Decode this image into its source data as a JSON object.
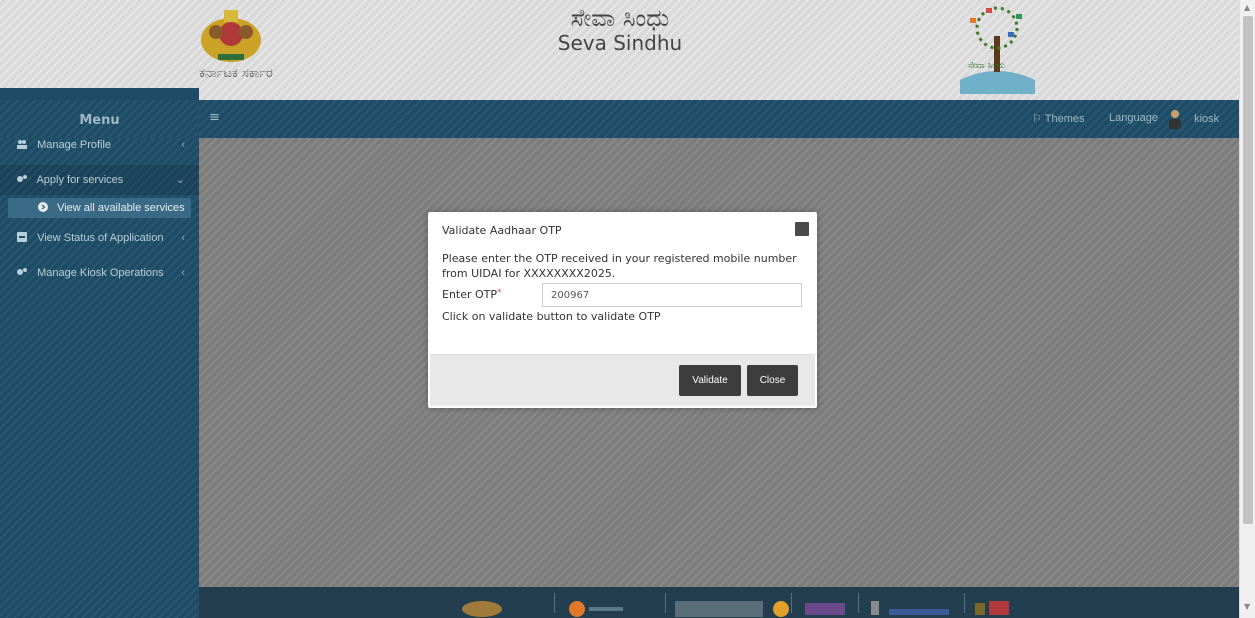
{
  "header": {
    "state_name": "ಕರ್ನಾಟಕ ಸರ್ಕಾರ",
    "title_kannada": "ಸೇವಾ ಸಿಂಧು",
    "title_english": "Seva Sindhu",
    "logo_text": "ಸೇವಾ ಸಿಂಧು"
  },
  "sidebar": {
    "menu_label": "Menu",
    "items": [
      {
        "label": "Manage Profile",
        "icon": "users-icon"
      },
      {
        "label": "Apply for services",
        "icon": "gears-icon"
      },
      {
        "label": "View all available services",
        "icon": "arrow-circle-icon"
      },
      {
        "label": "View Status of Application",
        "icon": "tablet-icon"
      },
      {
        "label": "Manage Kiosk Operations",
        "icon": "gears-icon"
      }
    ]
  },
  "topbar": {
    "hamburger_icon": "hamburger-icon",
    "themes_label": "Themes",
    "language_label": "Language",
    "user_label": "kiosk"
  },
  "modal": {
    "title": "Validate Aadhaar OTP",
    "message": "Please enter the OTP received in your registered mobile number from UIDAI for XXXXXXXX2025.",
    "otp_label": "Enter OTP",
    "required_mark": "*",
    "otp_value": "200967",
    "hint": "Click on validate button to validate OTP",
    "validate_label": "Validate",
    "close_label": "Close"
  },
  "colors": {
    "sidebar_bg": "#1e4c66",
    "button_bg": "#3d3d3d",
    "required": "#d9534f"
  }
}
